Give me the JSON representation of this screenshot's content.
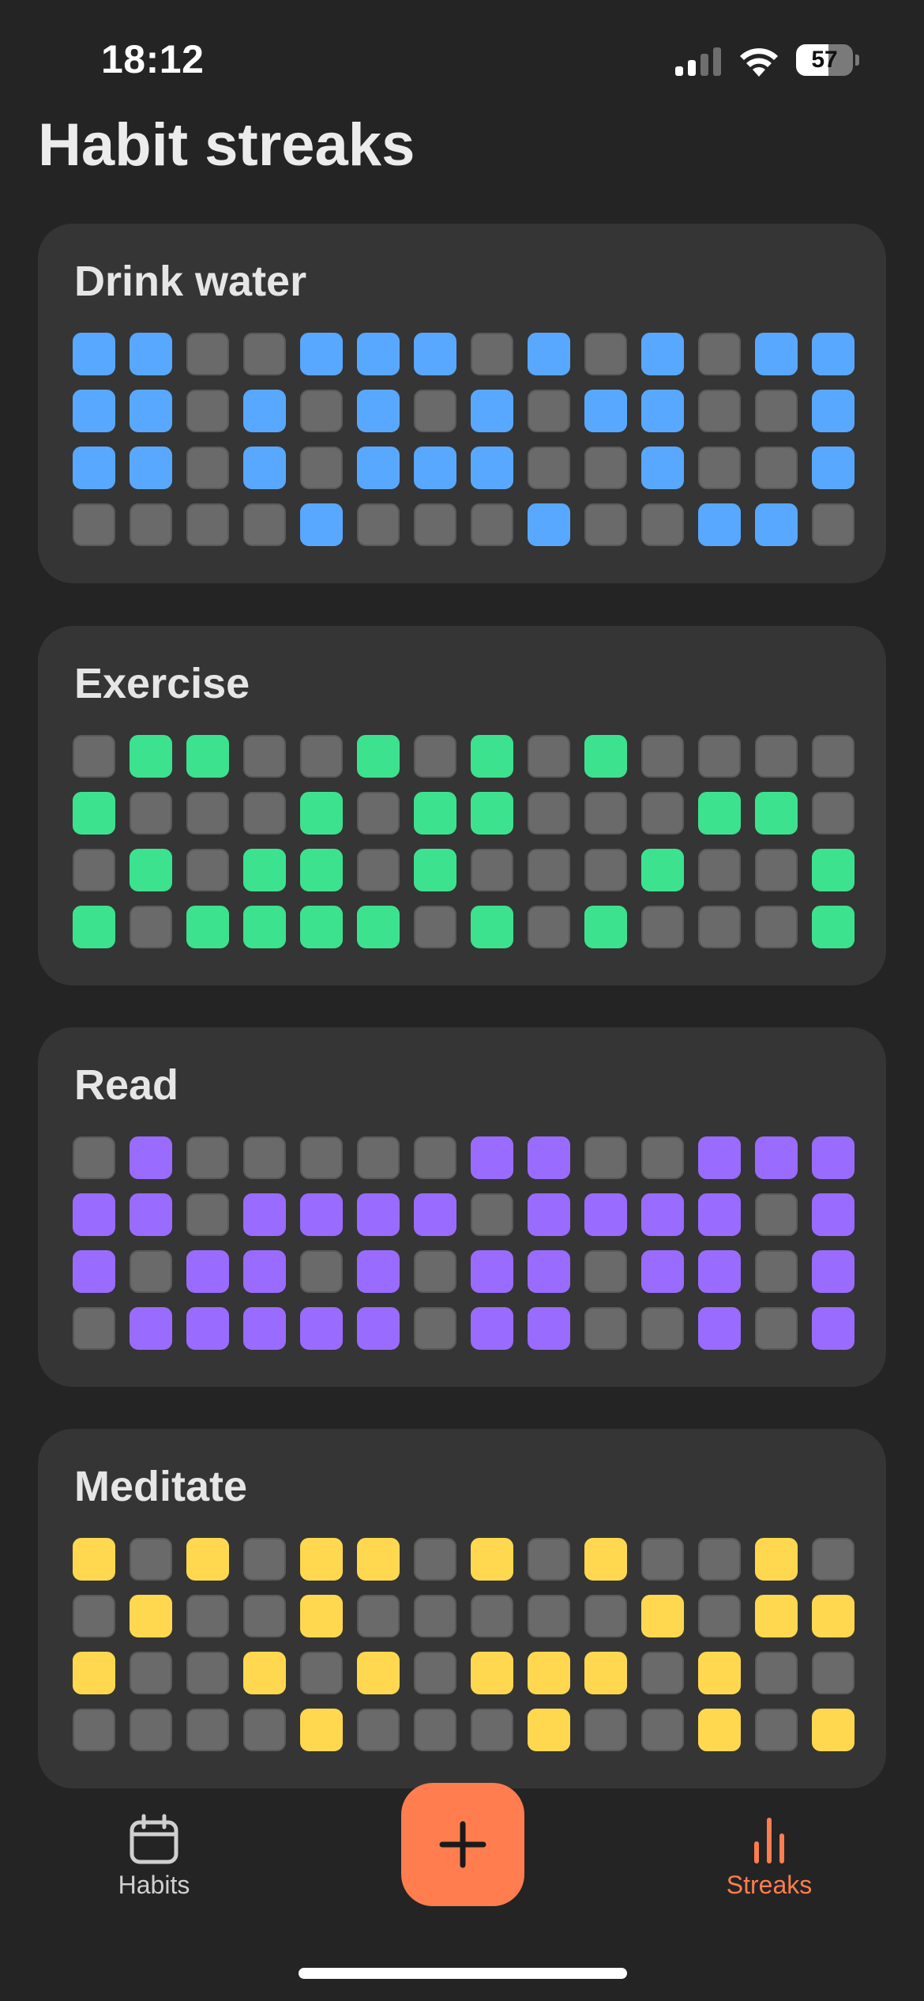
{
  "status_bar": {
    "time": "18:12",
    "battery_percent": "57",
    "battery_level": 0.57,
    "signal_bars_active": 2
  },
  "page": {
    "title": "Habit streaks"
  },
  "habits": [
    {
      "name": "Drink water",
      "color": "#58a8ff",
      "grid": [
        [
          1,
          1,
          0,
          0,
          1,
          1,
          1,
          0,
          1,
          0,
          1,
          0,
          1,
          1
        ],
        [
          1,
          1,
          0,
          1,
          0,
          1,
          0,
          1,
          0,
          1,
          1,
          0,
          0,
          1
        ],
        [
          1,
          1,
          0,
          1,
          0,
          1,
          1,
          1,
          0,
          0,
          1,
          0,
          0,
          1
        ],
        [
          0,
          0,
          0,
          0,
          1,
          0,
          0,
          0,
          1,
          0,
          0,
          1,
          1,
          0
        ]
      ]
    },
    {
      "name": "Exercise",
      "color": "#3de28f",
      "grid": [
        [
          0,
          1,
          1,
          0,
          0,
          1,
          0,
          1,
          0,
          1,
          0,
          0,
          0,
          0
        ],
        [
          1,
          0,
          0,
          0,
          1,
          0,
          1,
          1,
          0,
          0,
          0,
          1,
          1,
          0
        ],
        [
          0,
          1,
          0,
          1,
          1,
          0,
          1,
          0,
          0,
          0,
          1,
          0,
          0,
          1
        ],
        [
          1,
          0,
          1,
          1,
          1,
          1,
          0,
          1,
          0,
          1,
          0,
          0,
          0,
          1
        ]
      ]
    },
    {
      "name": "Read",
      "color": "#9a6bff",
      "grid": [
        [
          0,
          1,
          0,
          0,
          0,
          0,
          0,
          1,
          1,
          0,
          0,
          1,
          1,
          1
        ],
        [
          1,
          1,
          0,
          1,
          1,
          1,
          1,
          0,
          1,
          1,
          1,
          1,
          0,
          1
        ],
        [
          1,
          0,
          1,
          1,
          0,
          1,
          0,
          1,
          1,
          0,
          1,
          1,
          0,
          1
        ],
        [
          0,
          1,
          1,
          1,
          1,
          1,
          0,
          1,
          1,
          0,
          0,
          1,
          0,
          1
        ]
      ]
    },
    {
      "name": "Meditate",
      "color": "#ffd84f",
      "grid": [
        [
          1,
          0,
          1,
          0,
          1,
          1,
          0,
          1,
          0,
          1,
          0,
          0,
          1,
          0
        ],
        [
          0,
          1,
          0,
          0,
          1,
          0,
          0,
          0,
          0,
          0,
          1,
          0,
          1,
          1
        ],
        [
          1,
          0,
          0,
          1,
          0,
          1,
          0,
          1,
          1,
          1,
          0,
          1,
          0,
          0
        ],
        [
          0,
          0,
          0,
          0,
          1,
          0,
          0,
          0,
          1,
          0,
          0,
          1,
          0,
          1
        ]
      ]
    }
  ],
  "tab_bar": {
    "habits_label": "Habits",
    "streaks_label": "Streaks",
    "add_symbol": "+",
    "active_color": "#ff7d4e",
    "inactive_color": "#d0d0d0"
  }
}
